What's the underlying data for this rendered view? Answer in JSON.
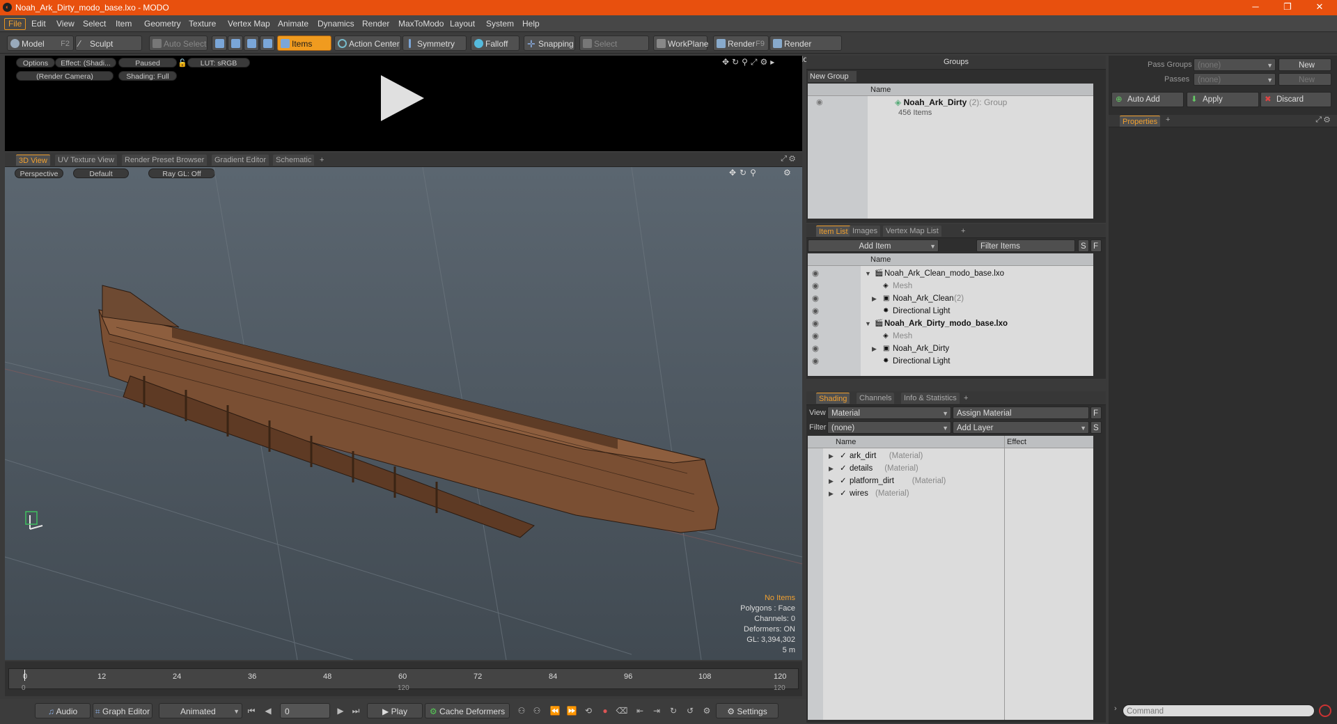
{
  "window": {
    "title": "Noah_Ark_Dirty_modo_base.lxo - MODO",
    "minimize": "─",
    "maximize": "❐",
    "close": "✕"
  },
  "menu": [
    "File",
    "Edit",
    "View",
    "Select",
    "Item",
    "Geometry",
    "Texture",
    "Vertex Map",
    "Animate",
    "Dynamics",
    "Render",
    "MaxToModo",
    "Layout",
    "System",
    "Help"
  ],
  "toolbar": {
    "model": "Model",
    "model_key": "F2",
    "sculpt": "Sculpt",
    "auto_select": "Auto Select",
    "items": "Items",
    "action_center": "Action Center",
    "symmetry": "Symmetry",
    "falloff": "Falloff",
    "snapping": "Snapping",
    "select_through": "Select Through",
    "workplane": "WorkPlane",
    "render": "Render",
    "render_key": "F9",
    "render_window": "Render Window"
  },
  "render_panel": {
    "options": "Options",
    "effect": "Effect: (Shadi...",
    "paused": "Paused",
    "lut": "LUT: sRGB",
    "camera": "(Render Camera)",
    "shading": "Shading: Full"
  },
  "viewport_tabs": [
    "3D View",
    "UV Texture View",
    "Render Preset Browser",
    "Gradient Editor",
    "Schematic",
    "+"
  ],
  "viewport": {
    "perspective": "Perspective",
    "default": "Default",
    "raygl": "Ray GL: Off",
    "hud": {
      "items": "No Items",
      "polygons": "Polygons : Face",
      "channels": "Channels: 0",
      "deformers": "Deformers: ON",
      "gl": "GL: 3,394,302",
      "scale": "5 m"
    }
  },
  "timeline": {
    "ticks": [
      "0",
      "12",
      "24",
      "36",
      "48",
      "60",
      "72",
      "84",
      "96",
      "108",
      "120"
    ],
    "start": "0",
    "end": "120",
    "current": "120"
  },
  "bottom": {
    "audio": "Audio",
    "graph_editor": "Graph Editor",
    "animated": "Animated",
    "frame": "0",
    "play": "Play",
    "cache": "Cache Deformers",
    "settings": "Settings"
  },
  "groups": {
    "title": "Groups",
    "new_group": "New Group",
    "col_name": "Name",
    "group_name": "Noah_Ark_Dirty",
    "group_count": "(2)",
    "group_type": ": Group",
    "group_items": "456 Items"
  },
  "itemlist": {
    "tabs": [
      "Item List",
      "Images",
      "Vertex Map List",
      "+"
    ],
    "add_item": "Add Item",
    "filter": "Filter Items",
    "s": "S",
    "f": "F",
    "col_name": "Name",
    "rows": [
      {
        "label": "Noah_Ark_Clean_modo_base.lxo",
        "extra": "",
        "bold": false,
        "indent": 0,
        "expand": "▼",
        "icon": "scene"
      },
      {
        "label": "Mesh",
        "extra": "",
        "bold": false,
        "indent": 1,
        "expand": "",
        "icon": "mesh",
        "muted": true
      },
      {
        "label": "Noah_Ark_Clean",
        "extra": "(2)",
        "bold": false,
        "indent": 1,
        "expand": "▶",
        "icon": "group"
      },
      {
        "label": "Directional Light",
        "extra": "",
        "bold": false,
        "indent": 1,
        "expand": "",
        "icon": "light"
      },
      {
        "label": "Noah_Ark_Dirty_modo_base.lxo",
        "extra": "",
        "bold": true,
        "indent": 0,
        "expand": "▼",
        "icon": "scene"
      },
      {
        "label": "Mesh",
        "extra": "",
        "bold": false,
        "indent": 1,
        "expand": "",
        "icon": "mesh",
        "muted": true
      },
      {
        "label": "Noah_Ark_Dirty",
        "extra": "",
        "bold": false,
        "indent": 1,
        "expand": "▶",
        "icon": "group"
      },
      {
        "label": "Directional Light",
        "extra": "",
        "bold": false,
        "indent": 1,
        "expand": "",
        "icon": "light"
      }
    ]
  },
  "shading": {
    "tabs": [
      "Shading",
      "Channels",
      "Info & Statistics",
      "+"
    ],
    "view_label": "View",
    "view_value": "Material",
    "assign": "Assign Material",
    "filter_label": "Filter",
    "filter_value": "(none)",
    "add_layer": "Add Layer",
    "f": "F",
    "s": "S",
    "col_name": "Name",
    "col_effect": "Effect",
    "rows": [
      {
        "name": "ark_dirt",
        "type": "(Material)"
      },
      {
        "name": "details",
        "type": "(Material)"
      },
      {
        "name": "platform_dirt",
        "type": "(Material)"
      },
      {
        "name": "wires",
        "type": "(Material)"
      }
    ]
  },
  "right": {
    "pass_groups": "Pass Groups",
    "passes": "Passes",
    "none": "(none)",
    "new": "New",
    "auto_add": "Auto Add",
    "apply": "Apply",
    "discard": "Discard",
    "properties": "Properties",
    "command": "Command"
  }
}
